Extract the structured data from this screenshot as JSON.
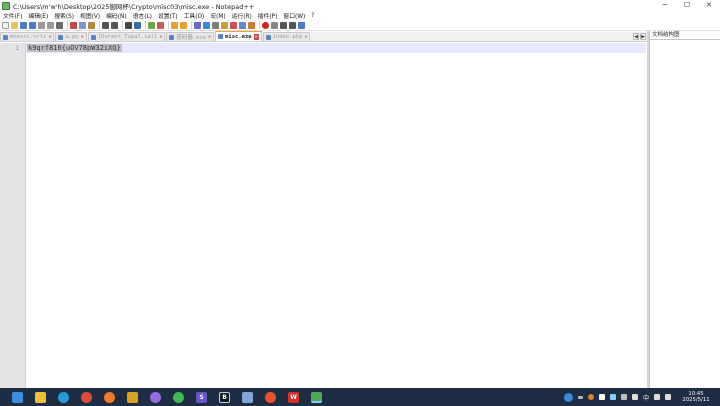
{
  "window": {
    "title": "C:\\Users\\m'w'h\\Desktop\\2025御网杯\\Crypto\\misc03\\misc.exe - Notepad++",
    "controls": [
      "─",
      "☐",
      "✕"
    ]
  },
  "menu": [
    "文件(F)",
    "编辑(E)",
    "搜索(S)",
    "视图(V)",
    "编码(N)",
    "语言(L)",
    "设置(T)",
    "工具(O)",
    "宏(M)",
    "运行(R)",
    "插件(P)",
    "窗口(W)",
    "?"
  ],
  "tabs": [
    {
      "label": "mnexxc.vrtx",
      "active": false
    },
    {
      "label": "a.py",
      "active": false
    },
    {
      "label": "[Durant_Tupal.sal]",
      "active": false
    },
    {
      "label": "密码器.exe",
      "active": false
    },
    {
      "label": "misc.exe",
      "active": true
    },
    {
      "label": "index.php",
      "active": false
    }
  ],
  "tab_nav": [
    "◀",
    "▶",
    "▼"
  ],
  "editor": {
    "line_number": "1",
    "content": "k9qrf816{uOV78pW32iXQ}"
  },
  "side_panel": {
    "title": "文档结构图"
  },
  "taskbar": {
    "apps": [
      {
        "name": "start",
        "color": "#3c8ee0"
      },
      {
        "name": "file-explorer",
        "color": "#f2c037"
      },
      {
        "name": "edge",
        "color": "#2a9ad6"
      },
      {
        "name": "chrome",
        "color": "#e44a3a"
      },
      {
        "name": "firefox",
        "color": "#f07a26"
      },
      {
        "name": "app-folder",
        "color": "#d9a21f"
      },
      {
        "name": "app-purple",
        "color": "#9a6be0"
      },
      {
        "name": "wechat",
        "color": "#3dbb52"
      },
      {
        "name": "app-s",
        "color": "#6a55c8",
        "glyph": "S"
      },
      {
        "name": "app-b",
        "color": "#0f1a24",
        "glyph": "B"
      },
      {
        "name": "app-docs",
        "color": "#7fa8d8"
      },
      {
        "name": "app-red",
        "color": "#e8552b"
      },
      {
        "name": "wps",
        "color": "#d8312b",
        "glyph": "W"
      },
      {
        "name": "notepadpp",
        "color": "#4daa55"
      }
    ],
    "tray_lang": "中",
    "time": "10:45",
    "date": "2025/5/11"
  }
}
